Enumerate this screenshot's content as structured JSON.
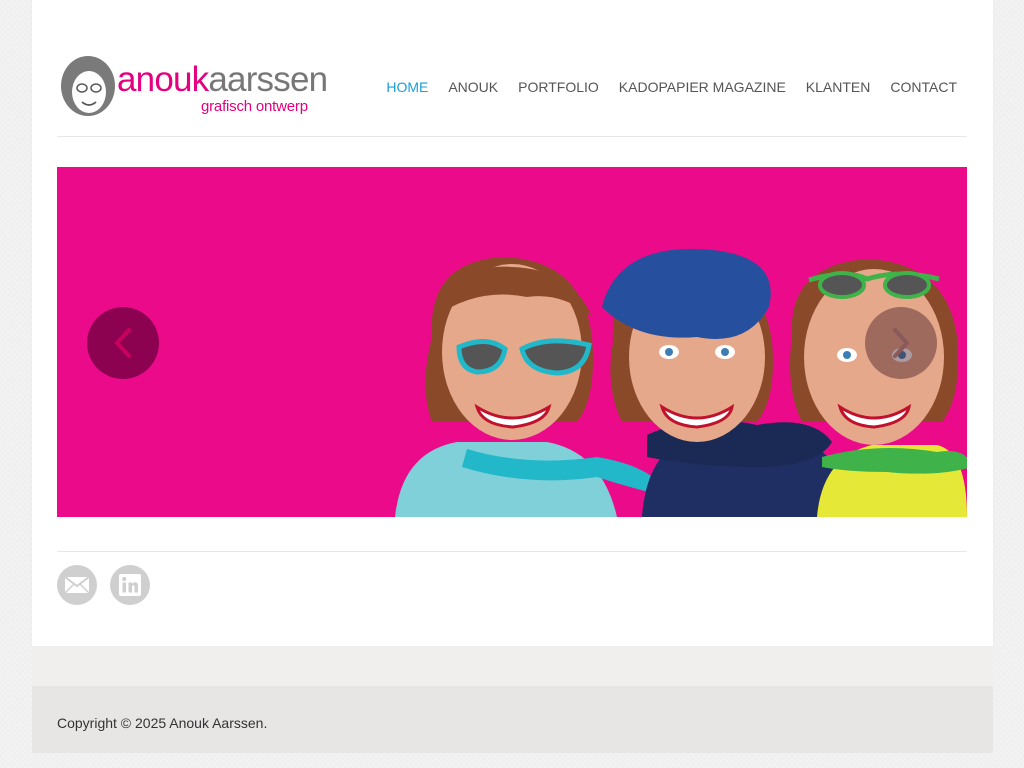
{
  "brand": {
    "name_part1": "anouk",
    "name_part2": "aarssen",
    "tagline": "grafisch ontwerp",
    "pink": "#e4007f",
    "grey": "#777777"
  },
  "nav": {
    "items": [
      {
        "label": "HOME",
        "active": true
      },
      {
        "label": "ANOUK",
        "active": false
      },
      {
        "label": "PORTFOLIO",
        "active": false
      },
      {
        "label": "KADOPAPIER MAGAZINE",
        "active": false
      },
      {
        "label": "KLANTEN",
        "active": false
      },
      {
        "label": "CONTACT",
        "active": false
      }
    ],
    "active_color": "#1a9fd9",
    "color": "#555555"
  },
  "slider": {
    "background": "#eb0a8a",
    "prev_icon": "chevron-left-icon",
    "next_icon": "chevron-right-icon"
  },
  "social": {
    "items": [
      {
        "icon": "mail-icon"
      },
      {
        "icon": "linkedin-icon"
      }
    ]
  },
  "footer": {
    "copyright": "Copyright © 2025 Anouk Aarssen."
  }
}
